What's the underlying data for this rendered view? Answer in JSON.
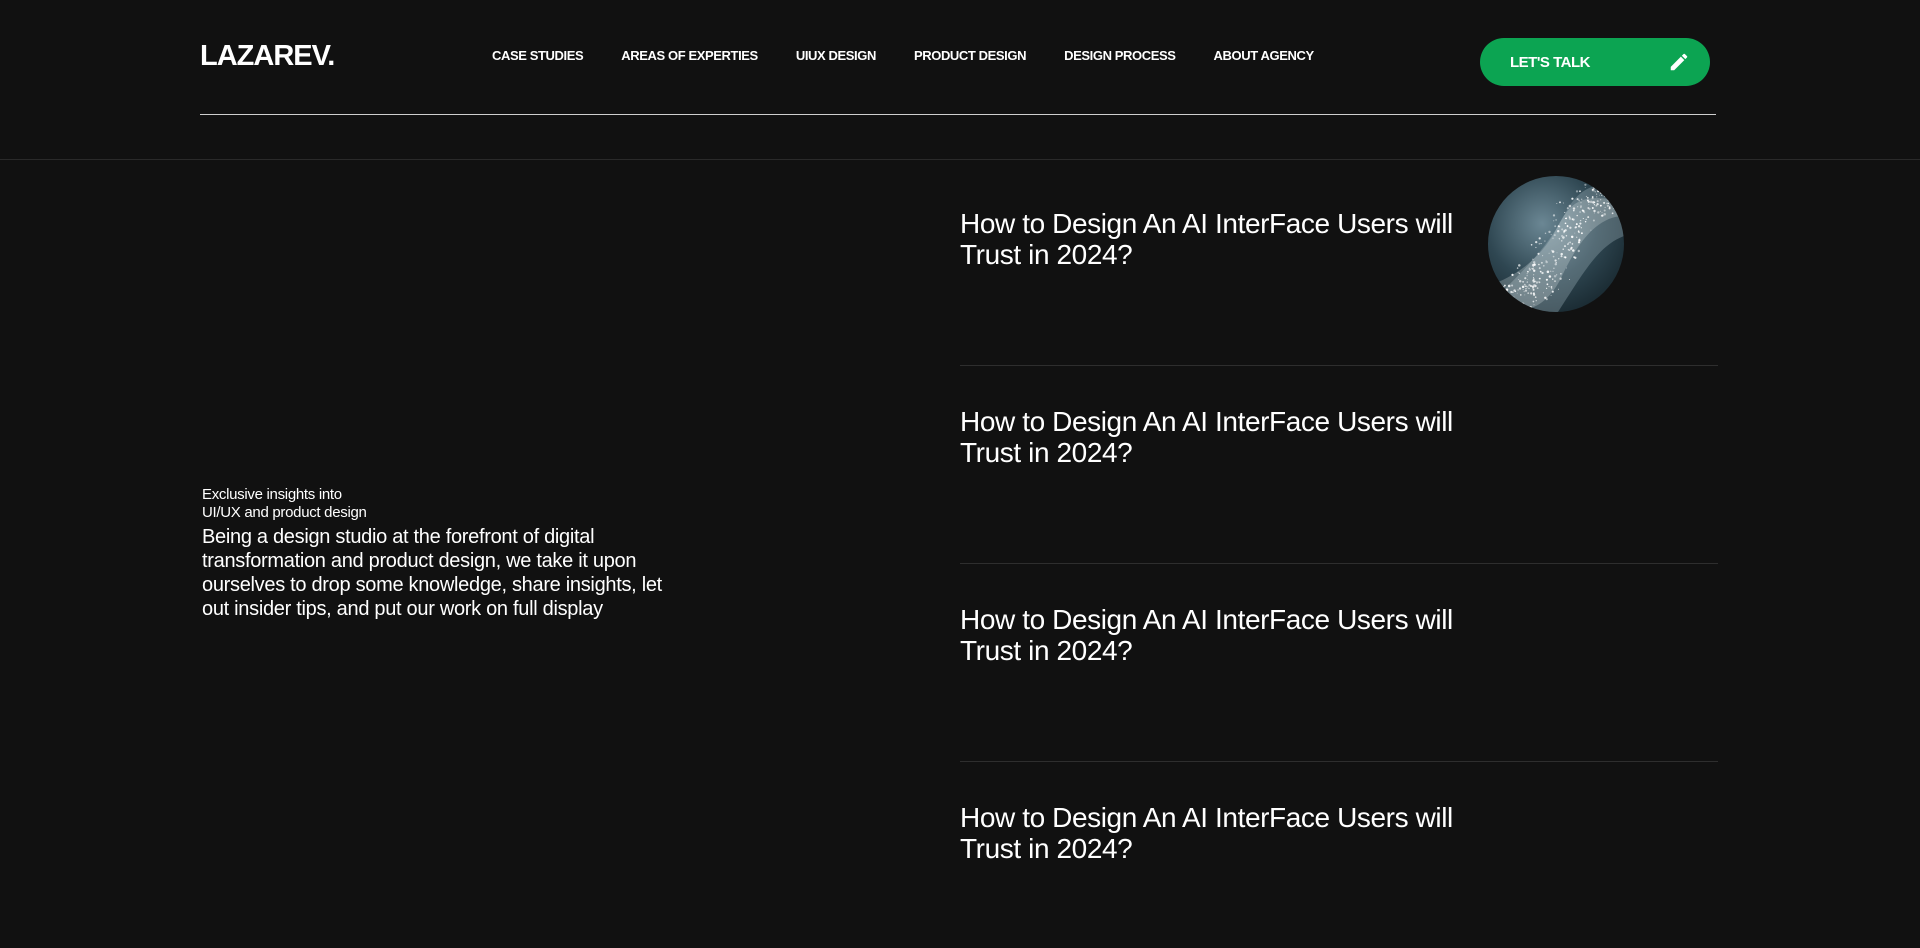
{
  "header": {
    "logo": "LAZAREV.",
    "nav": [
      {
        "label": "CASE STUDIES"
      },
      {
        "label": "AREAS OF EXPERTIES"
      },
      {
        "label": "UIUX DESIGN"
      },
      {
        "label": "PRODUCT DESIGN"
      },
      {
        "label": "DESIGN PROCESS"
      },
      {
        "label": "ABOUT AGENCY"
      }
    ],
    "cta_label": "LET'S TALK",
    "cta_icon": "pencil-icon",
    "cta_color": "#0ca452"
  },
  "intro": {
    "kicker_line1": "Exclusive insights into",
    "kicker_line2": "UI/UX and product design",
    "body": "Being a design studio at the forefront of digital transformation and product design, we take it upon ourselves to drop some knowledge, share insights, let out insider tips, and put our work on full display"
  },
  "articles": [
    {
      "title": "How to Design An AI InterFace Users will Trust in 2024?"
    },
    {
      "title": "How to Design An AI InterFace Users will Trust in 2024?"
    },
    {
      "title": "How to Design An AI InterFace Users will Trust in 2024?"
    },
    {
      "title": "How to Design An AI InterFace Users will Trust in 2024?"
    }
  ],
  "colors": {
    "background": "#111111",
    "accent": "#0ca452",
    "text": "#ffffff"
  }
}
